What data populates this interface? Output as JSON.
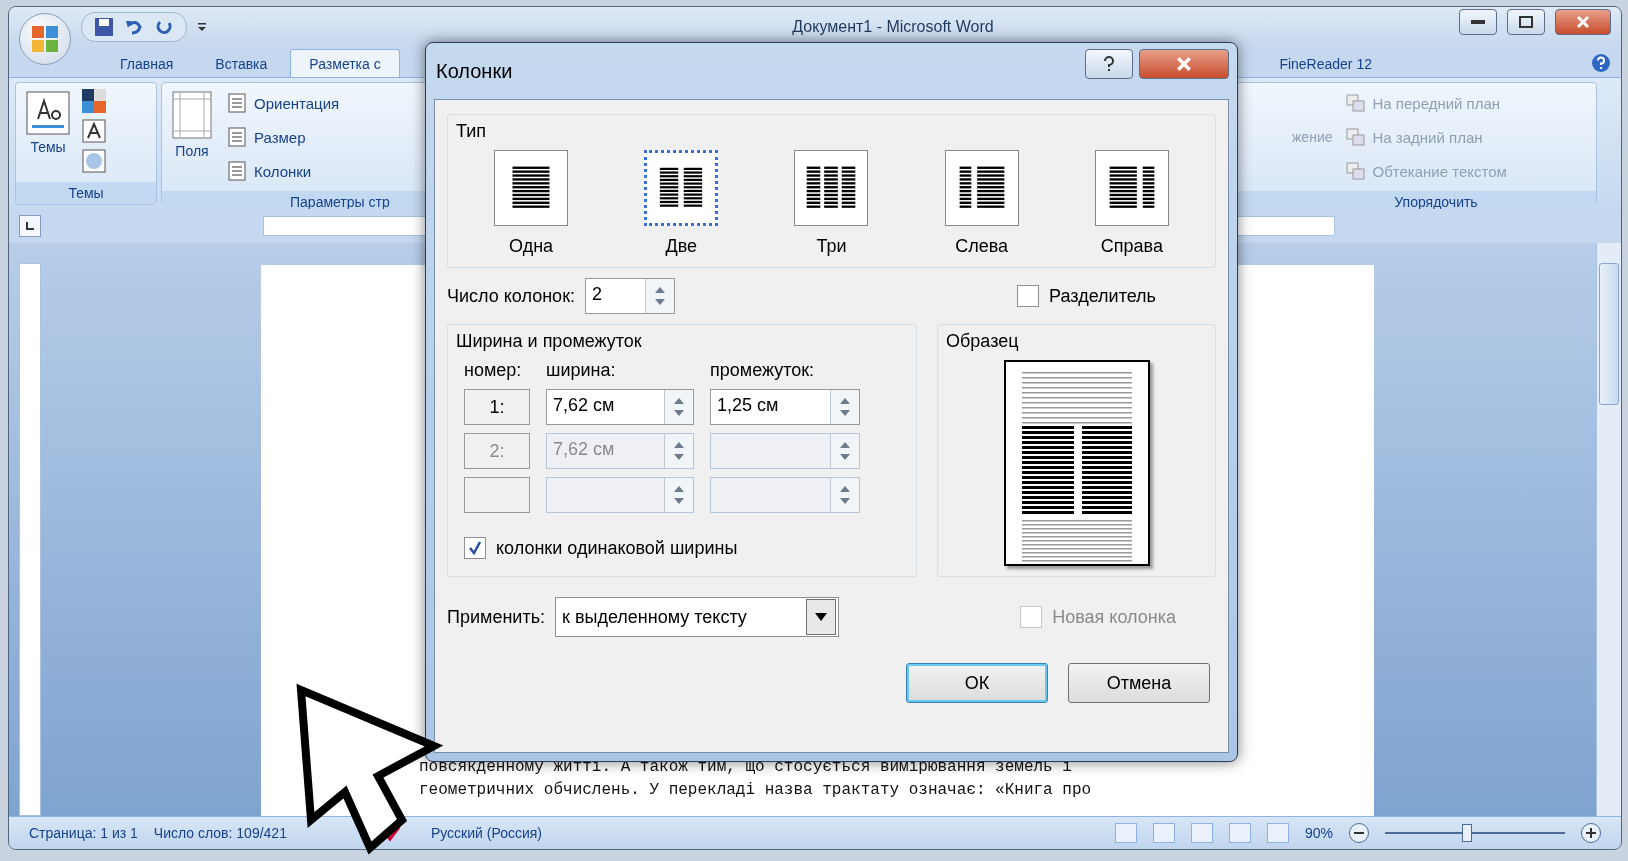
{
  "window": {
    "title": "Документ1 - Microsoft Word"
  },
  "ribbon_tabs": [
    {
      "label": "Главная",
      "selected": false
    },
    {
      "label": "Вставка",
      "selected": false
    },
    {
      "label": "Разметка с",
      "selected": true
    },
    {
      "label": "FineReader 12",
      "selected": false
    }
  ],
  "themes_group": {
    "button": "Темы",
    "label": "Темы"
  },
  "page_group": {
    "button": "Поля",
    "label": "Параметры стр",
    "items": [
      {
        "label": "Ориентация",
        "disabled": false
      },
      {
        "label": "Размер",
        "disabled": false
      },
      {
        "label": "Колонки",
        "disabled": false
      }
    ]
  },
  "arrange_group": {
    "partial": "жение",
    "label": "Упорядочить",
    "items": [
      {
        "label": "На передний план",
        "disabled": true
      },
      {
        "label": "На задний план",
        "disabled": true
      },
      {
        "label": "Обтекание текстом",
        "disabled": true
      }
    ]
  },
  "document": {
    "lines": [
      "повсякденному житті. А також тим, що стосується вимірювання земель і",
      "геометричних обчислень. У перекладі назва трактату означає: «Книга про"
    ]
  },
  "status_bar": {
    "page": "Страница: 1 из 1",
    "words": "Число слов: 109/421",
    "language": "Русский (Россия)",
    "zoom": "90%",
    "zoom_slider": {
      "level": 0.45
    }
  },
  "dialog": {
    "title": "Колонки",
    "type_label": "Тип",
    "presets": [
      {
        "kind": "one",
        "label": "Одна",
        "selected": false
      },
      {
        "kind": "two",
        "label": "Две",
        "selected": true
      },
      {
        "kind": "three",
        "label": "Три",
        "selected": false
      },
      {
        "kind": "left",
        "label": "Слева",
        "selected": false
      },
      {
        "kind": "right",
        "label": "Справа",
        "selected": false
      }
    ],
    "count_label": "Число колонок:",
    "count": "2",
    "separator": {
      "label": "Разделитель",
      "checked": false
    },
    "width_group": "Ширина и промежуток",
    "headers": [
      "номер:",
      "ширина:",
      "промежуток:"
    ],
    "rows": [
      {
        "number": "1:",
        "width": "7,62 см",
        "spacing": "1,25 см",
        "disabled": false
      },
      {
        "number": "2:",
        "width": "7,62 см",
        "disabled": true
      },
      {
        "disabled": true
      }
    ],
    "equal": {
      "label": "колонки одинаковой ширины",
      "checked": true
    },
    "sample_label": "Образец",
    "apply_label": "Применить:",
    "apply_value": "к выделенному тексту",
    "new_column": {
      "label": "Новая колонка",
      "checked": false,
      "disabled": true
    },
    "buttons": [
      "ОК",
      "Отмена"
    ]
  }
}
